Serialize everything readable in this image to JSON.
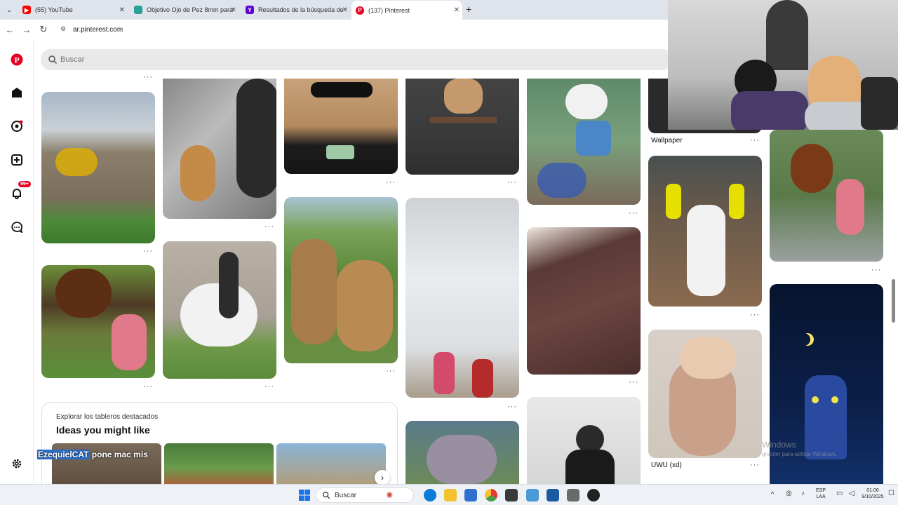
{
  "browser": {
    "tabs": [
      {
        "title": "(55) YouTube",
        "icon": "youtube-icon"
      },
      {
        "title": "Objetivo Ojo de Pez 8mm para",
        "icon": "page-icon"
      },
      {
        "title": "Resultados de la búsqueda de",
        "icon": "yahoo-icon"
      },
      {
        "title": "(137) Pinterest",
        "icon": "pinterest-icon"
      }
    ],
    "url": "ar.pinterest.com"
  },
  "search": {
    "placeholder": "Buscar"
  },
  "sidebar": {
    "notification_badge": "99+"
  },
  "pins": {
    "wallpaper_title": "Wallpaper",
    "uwu_title": "UWU (xd)"
  },
  "boards": {
    "subtitle": "Explorar los tableros destacados",
    "heading": "Ideas you might like"
  },
  "stream_overlay": {
    "name": "EzequielCAT",
    "text": "pone mac mis"
  },
  "watermark": {
    "line1": "Windows",
    "line2": "gración para activar Windows."
  },
  "taskbar": {
    "search_placeholder": "Buscar",
    "lang": "ESP",
    "lang2": "LAA",
    "time": "01:06",
    "date": "9/10/2025"
  },
  "colors": {
    "pinterest_red": "#e60023",
    "accent": "#2d72d2"
  }
}
